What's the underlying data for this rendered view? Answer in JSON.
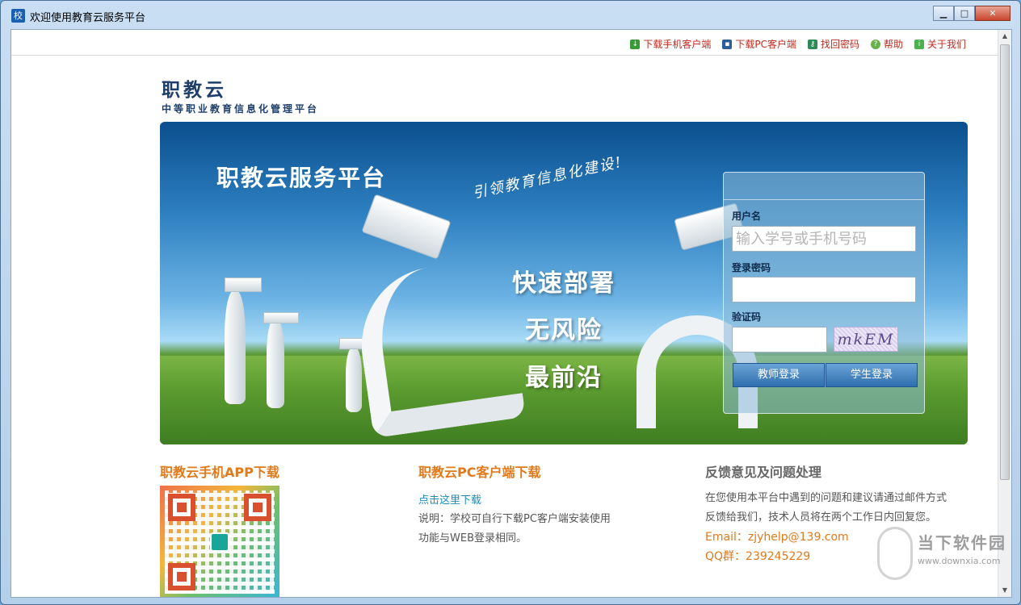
{
  "window": {
    "title": "欢迎使用教育云服务平台",
    "app_icon_char": "校",
    "minimize": "▁",
    "maximize": "□",
    "close": "✕"
  },
  "toplinks": [
    {
      "label": "下载手机客户端",
      "icon": "download-icon",
      "color": "#3a9a3a"
    },
    {
      "label": "下载PC客户端",
      "icon": "pc-icon",
      "color": "#2b5f9a"
    },
    {
      "label": "找回密码",
      "icon": "key-icon",
      "color": "#2e8b57"
    },
    {
      "label": "帮助",
      "icon": "help-icon",
      "color": "#6ab04c"
    },
    {
      "label": "关于我们",
      "icon": "info-icon",
      "color": "#4caf50"
    }
  ],
  "logo": {
    "title": "职教云",
    "subtitle": "中等职业教育信息化管理平台"
  },
  "banner": {
    "title": "职教云服务平台",
    "slogan": "引领教育信息化建设!",
    "features": [
      "快速部署",
      "无风险",
      "最前沿"
    ]
  },
  "login": {
    "username_label": "用户名",
    "username_placeholder": "输入学号或手机号码",
    "password_label": "登录密码",
    "captcha_label": "验证码",
    "captcha_text": "mkEM",
    "teacher_login": "教师登录",
    "student_login": "学生登录"
  },
  "app_section": {
    "title": "职教云手机APP下载"
  },
  "pc_section": {
    "title": "职教云PC客户端下载",
    "link": "点击这里下载",
    "desc_line1": "说明：学校可自行下载PC客户端安装使用",
    "desc_line2": "功能与WEB登录相同。"
  },
  "feedback_section": {
    "title": "反馈意见及问题处理",
    "desc_line1": "在您使用本平台中遇到的问题和建议请通过邮件方式",
    "desc_line2": "反馈给我们，技术人员将在两个工作日内回复您。",
    "email": "Email：zjyhelp@139.com",
    "qq": "QQ群：239245229"
  },
  "watermark": {
    "text": "当下软件园",
    "url": "www.downxia.com"
  }
}
